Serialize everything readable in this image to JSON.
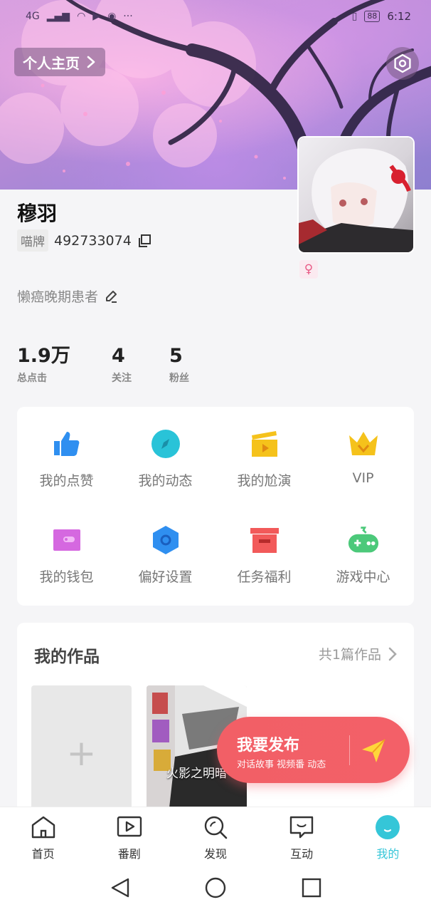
{
  "status_bar": {
    "network": "4G",
    "battery": "88",
    "time": "6:12"
  },
  "header": {
    "home_label": "个人主页"
  },
  "profile": {
    "username": "穆羽",
    "uid_tag": "喵牌",
    "uid": "492733074",
    "bio": "懒癌晚期患者"
  },
  "stats": [
    {
      "value": "1.9万",
      "label": "总点击"
    },
    {
      "value": "4",
      "label": "关注"
    },
    {
      "value": "5",
      "label": "粉丝"
    }
  ],
  "menu": [
    {
      "label": "我的点赞",
      "icon": "thumbs-up-icon",
      "color": "#2f8ff0"
    },
    {
      "label": "我的动态",
      "icon": "compass-icon",
      "color": "#29c3d8"
    },
    {
      "label": "我的尬演",
      "icon": "clapperboard-icon",
      "color": "#f5c21b"
    },
    {
      "label": "VIP",
      "icon": "crown-icon",
      "color": "#f5c21b"
    },
    {
      "label": "我的钱包",
      "icon": "wallet-icon",
      "color": "#d568e0"
    },
    {
      "label": "偏好设置",
      "icon": "hexagon-settings-icon",
      "color": "#2f8ff0"
    },
    {
      "label": "任务福利",
      "icon": "gift-box-icon",
      "color": "#f25a5a"
    },
    {
      "label": "游戏中心",
      "icon": "gamepad-icon",
      "color": "#4cc97a"
    }
  ],
  "works": {
    "title": "我的作品",
    "count_label": "共1篇作品",
    "items": [
      {
        "title": "火影之明暗"
      }
    ]
  },
  "publish": {
    "title": "我要发布",
    "subtitle": "对话故事 视频番 动态"
  },
  "bottom_nav": [
    {
      "label": "首页",
      "icon": "home-icon"
    },
    {
      "label": "番剧",
      "icon": "play-icon"
    },
    {
      "label": "发现",
      "icon": "search-icon"
    },
    {
      "label": "互动",
      "icon": "chat-icon"
    },
    {
      "label": "我的",
      "icon": "profile-icon",
      "active": true
    }
  ],
  "colors": {
    "accent": "#35c6d8",
    "publish": "#f25f66"
  }
}
